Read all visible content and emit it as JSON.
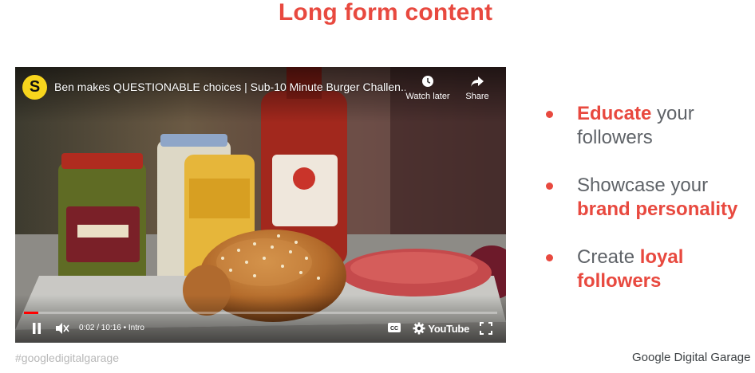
{
  "slide": {
    "title": "Long form content"
  },
  "player": {
    "channel_initial": "S",
    "video_title": "Ben makes QUESTIONABLE choices | Sub-10 Minute Burger Challen...",
    "watch_later_label": "Watch later",
    "share_label": "Share",
    "time": "0:02 / 10:16",
    "chapter": "• Intro",
    "logo_text": "YouTube",
    "progress": 0.03
  },
  "bullets": [
    {
      "highlight": "Educate",
      "rest": " your followers"
    },
    {
      "before": "Showcase your ",
      "highlight": "brand personality"
    },
    {
      "before": "Create ",
      "highlight": "loyal followers"
    }
  ],
  "footer": {
    "hashtag": "#googledigitalgarage",
    "brand_google": "Google",
    "brand_rest": " Digital Garage"
  },
  "colors": {
    "accent": "#e8493f",
    "text_gray": "#5f6368"
  }
}
